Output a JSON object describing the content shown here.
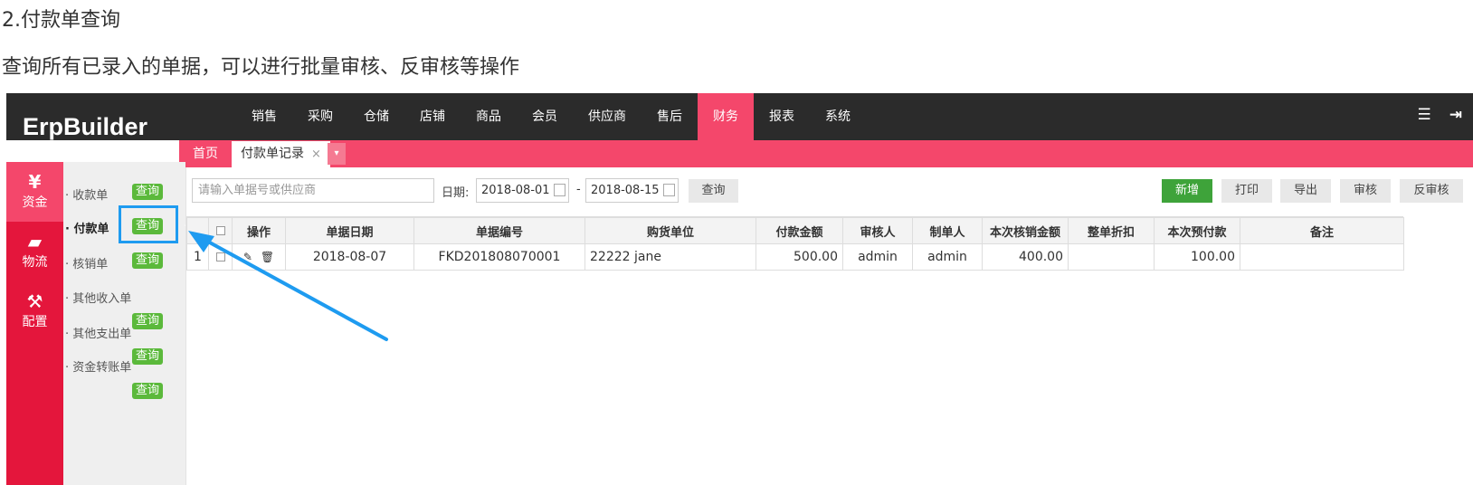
{
  "doc": {
    "heading": "2.付款单查询",
    "description": "查询所有已录入的单据，可以进行批量审核、反审核等操作"
  },
  "app": {
    "logo": "ErpBuilder",
    "nav": [
      "销售",
      "采购",
      "仓储",
      "店铺",
      "商品",
      "会员",
      "供应商",
      "售后",
      "财务",
      "报表",
      "系统"
    ],
    "nav_active": "财务",
    "top_icons": [
      "list-icon",
      "logout-icon"
    ],
    "tabs": {
      "home": "首页",
      "current": "付款单记录",
      "close": "×",
      "dropdown": "▾"
    },
    "sidebar": [
      {
        "icon": "¥",
        "label": "资金"
      },
      {
        "icon": "▰",
        "label": "物流"
      },
      {
        "icon": "⚒",
        "label": "配置"
      }
    ],
    "submenu": [
      {
        "label": "· 收款单",
        "badge": "查询"
      },
      {
        "label": "· 付款单",
        "badge": "查询"
      },
      {
        "label": "· 核销单",
        "badge": "查询"
      },
      {
        "label": "· 其他收入单",
        "badge": "查询"
      },
      {
        "label": "· 其他支出单",
        "badge": "查询"
      },
      {
        "label": "· 资金转账单",
        "badge": "查询"
      }
    ],
    "toolbar": {
      "search_placeholder": "请输入单据号或供应商",
      "date_label": "日期:",
      "date_from": "2018-08-01",
      "date_to": "2018-08-15",
      "dash": "-",
      "query": "查询",
      "add": "新增",
      "print": "打印",
      "export": "导出",
      "audit": "审核",
      "unaudit": "反审核"
    },
    "table": {
      "headers": [
        "",
        "",
        "操作",
        "单据日期",
        "单据编号",
        "购货单位",
        "付款金额",
        "审核人",
        "制单人",
        "本次核销金额",
        "整单折扣",
        "本次预付款",
        "备注"
      ],
      "rows": [
        {
          "index": "1",
          "date": "2018-08-07",
          "number": "FKD201808070001",
          "unit": "22222 jane",
          "amount": "500.00",
          "auditor": "admin",
          "maker": "admin",
          "writeoff": "400.00",
          "discount": "",
          "prepay": "100.00",
          "remark": ""
        }
      ]
    },
    "accent_color": "#f4476b",
    "sidebar_color": "#e4163c",
    "topbar_color": "#2b2b2b"
  }
}
